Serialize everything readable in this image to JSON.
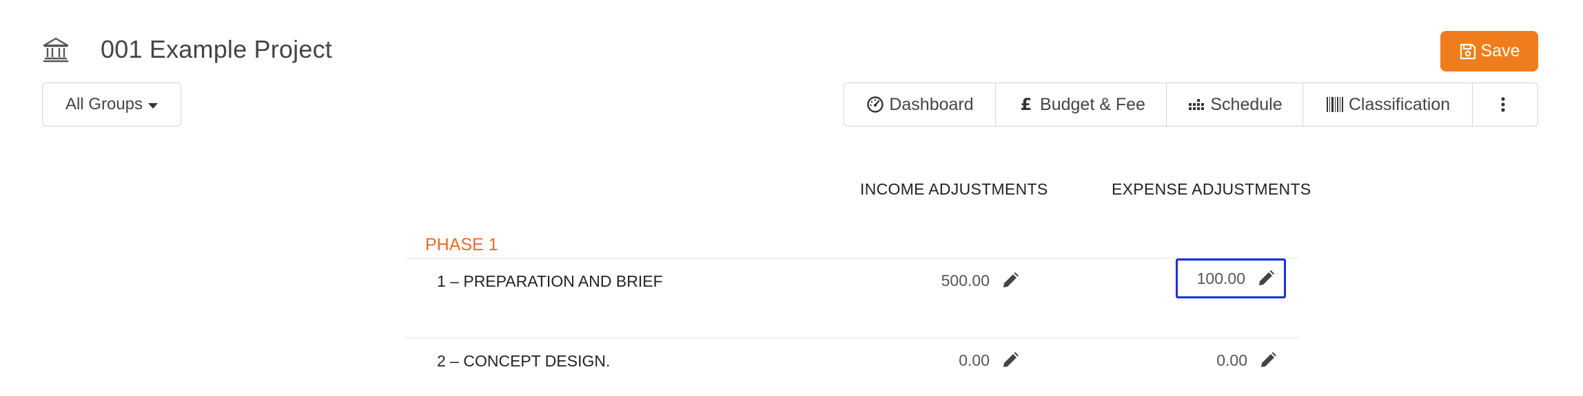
{
  "header": {
    "project_icon": "bank-building-icon",
    "title": "001 Example Project",
    "save_label": "Save",
    "save_icon": "floppy-disk-icon",
    "accent_color": "#f07d1d"
  },
  "toolbar": {
    "group_filter": "All Groups",
    "tabs": [
      {
        "label": "Dashboard",
        "icon": "speedometer-icon"
      },
      {
        "label": "Budget & Fee",
        "icon": "pound-sign-icon"
      },
      {
        "label": "Schedule",
        "icon": "bar-chart-dots-icon"
      },
      {
        "label": "Classification",
        "icon": "barcode-icon"
      },
      {
        "label": "",
        "icon": "vertical-ellipsis-icon"
      }
    ]
  },
  "table": {
    "columns": {
      "income": "INCOME ADJUSTMENTS",
      "expense": "EXPENSE ADJUSTMENTS"
    },
    "phase_title": "PHASE 1",
    "phase_color": "#e8692a",
    "rows": [
      {
        "label": "1 – PREPARATION AND BRIEF",
        "income": "500.00",
        "expense": "100.00"
      },
      {
        "label": "2 – CONCEPT DESIGN.",
        "income": "0.00",
        "expense": "0.00"
      }
    ],
    "focus_color": "#1a2ee0"
  }
}
